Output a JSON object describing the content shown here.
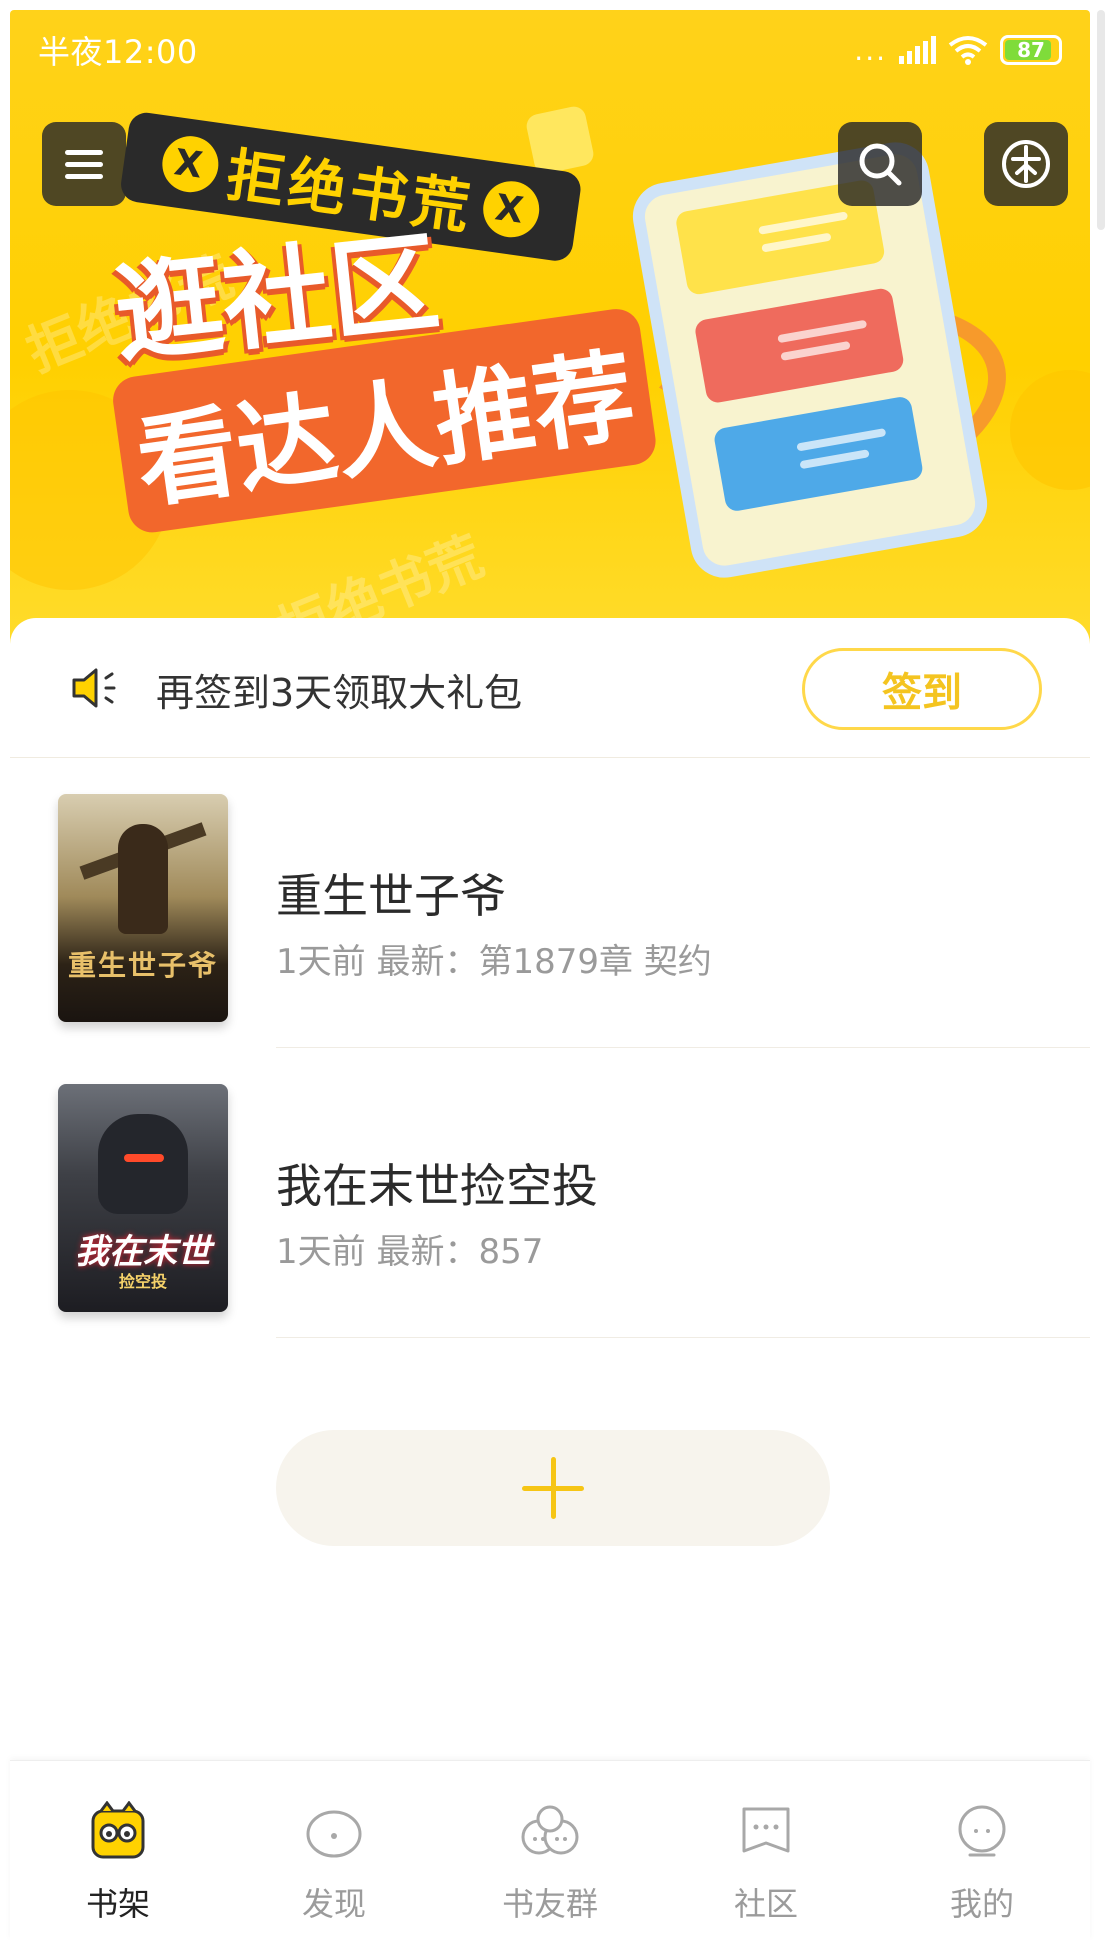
{
  "status_bar": {
    "time": "半夜12:00",
    "signal_dots": "...",
    "battery": "87"
  },
  "banner": {
    "tag_text": "拒绝书荒",
    "tag_mark": "X",
    "title_line1": "逛社区",
    "title_line2": "看达人推荐",
    "watermark": "拒绝书荒"
  },
  "signin": {
    "text": "再签到3天领取大礼包",
    "button_label": "签到"
  },
  "books": [
    {
      "title": "重生世子爷",
      "meta": "1天前 最新：第1879章 契约",
      "cover_text": "重生世子爷"
    },
    {
      "title": "我在末世捡空投",
      "meta": "1天前 最新：857",
      "cover_text": "我在末世",
      "cover_sub": "捡空投"
    }
  ],
  "bottom_nav": {
    "items": [
      {
        "label": "书架",
        "icon": "bookshelf-icon",
        "active": true
      },
      {
        "label": "发现",
        "icon": "discover-icon",
        "active": false
      },
      {
        "label": "书友群",
        "icon": "book-friends-icon",
        "active": false
      },
      {
        "label": "社区",
        "icon": "community-icon",
        "active": false
      },
      {
        "label": "我的",
        "icon": "profile-icon",
        "active": false
      }
    ]
  },
  "colors": {
    "brand_yellow": "#FFD200",
    "accent_orange": "#F2672C",
    "signin_border": "#FFD84A",
    "plus_yellow": "#F6C515"
  }
}
